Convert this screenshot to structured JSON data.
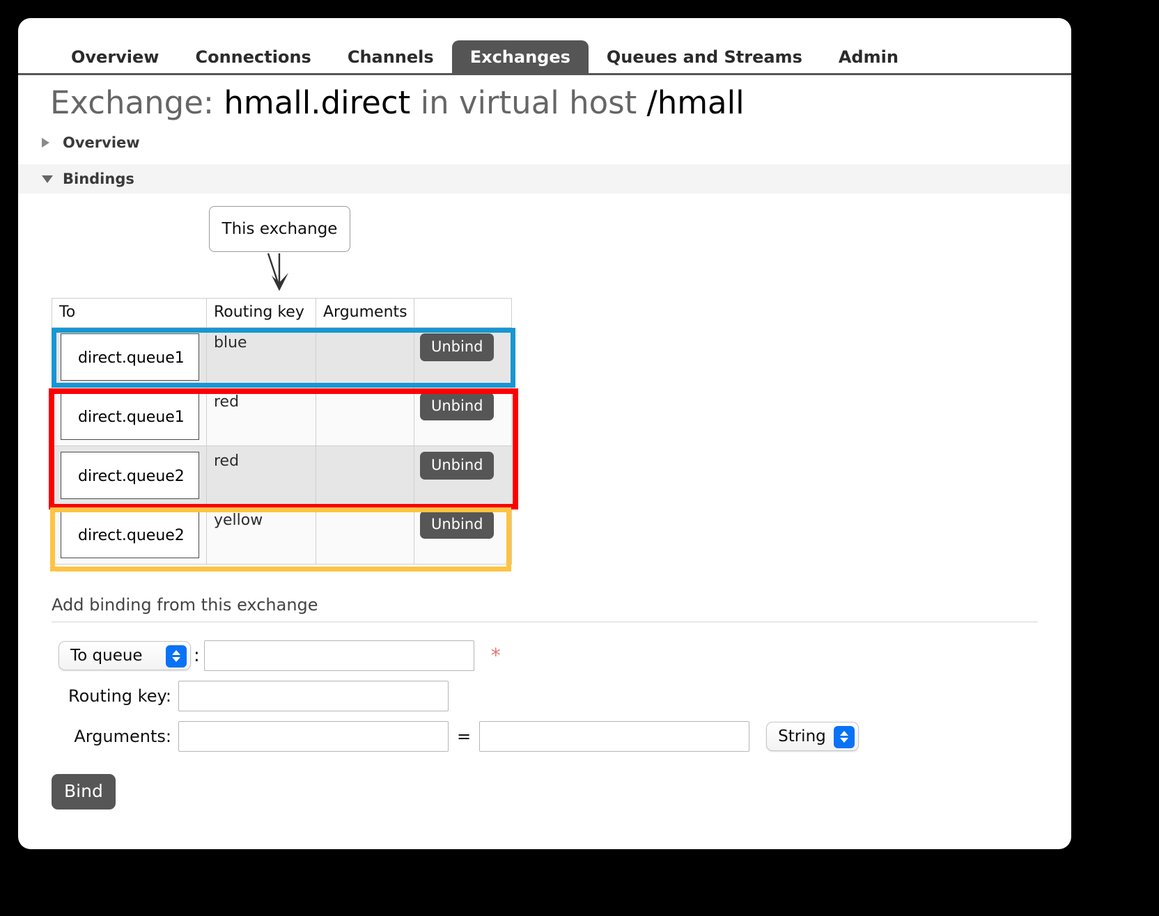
{
  "nav": {
    "tabs": [
      {
        "label": "Overview",
        "active": false
      },
      {
        "label": "Connections",
        "active": false
      },
      {
        "label": "Channels",
        "active": false
      },
      {
        "label": "Exchanges",
        "active": true
      },
      {
        "label": "Queues and Streams",
        "active": false
      },
      {
        "label": "Admin",
        "active": false
      }
    ]
  },
  "page": {
    "title_prefix": "Exchange:",
    "exchange_name": "hmall.direct",
    "title_middle": "in virtual host",
    "vhost": "/hmall"
  },
  "sections": {
    "overview_label": "Overview",
    "bindings_label": "Bindings"
  },
  "graph": {
    "this_exchange_label": "This exchange"
  },
  "bindings_table": {
    "headers": [
      "To",
      "Routing key",
      "Arguments",
      ""
    ],
    "rows": [
      {
        "to": "direct.queue1",
        "routing_key": "blue",
        "arguments": "",
        "action": "Unbind"
      },
      {
        "to": "direct.queue1",
        "routing_key": "red",
        "arguments": "",
        "action": "Unbind"
      },
      {
        "to": "direct.queue2",
        "routing_key": "red",
        "arguments": "",
        "action": "Unbind"
      },
      {
        "to": "direct.queue2",
        "routing_key": "yellow",
        "arguments": "",
        "action": "Unbind"
      }
    ]
  },
  "highlights": [
    {
      "name": "blue-highlight",
      "color": "#1896d3",
      "rows": [
        0
      ]
    },
    {
      "name": "red-highlight",
      "color": "#fb0000",
      "rows": [
        1,
        2
      ]
    },
    {
      "name": "yellow-highlight",
      "color": "#fec343",
      "rows": [
        3
      ]
    }
  ],
  "add_binding": {
    "heading": "Add binding from this exchange",
    "destination_select_value": "To queue",
    "destination_value": "",
    "destination_placeholder": "",
    "required_marker": "*",
    "colon": ":",
    "routing_key_label": "Routing key:",
    "routing_key_value": "",
    "arguments_label": "Arguments:",
    "argument_name_value": "",
    "argument_value_value": "",
    "equals": "=",
    "type_select_value": "String",
    "submit_label": "Bind"
  }
}
